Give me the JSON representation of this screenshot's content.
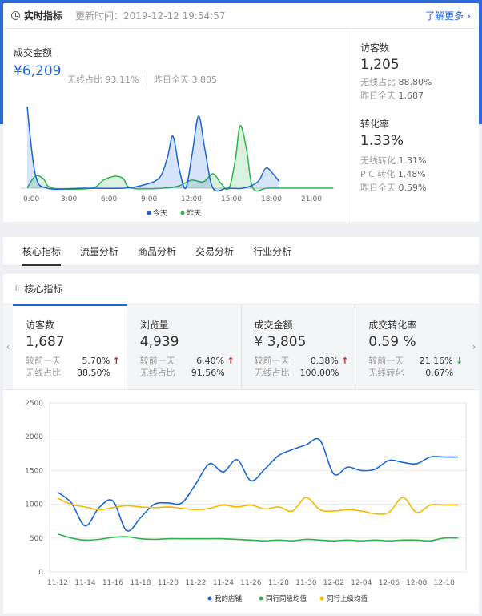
{
  "realtime": {
    "title": "实时指标",
    "update_label": "更新时间：2019-12-12 19:54:57",
    "more_label": "了解更多",
    "gmv": {
      "label": "成交金额",
      "value": "¥6,209",
      "wireless": "无线占比 93.11%",
      "yesterday": "昨日全天 3,805"
    },
    "visitors": {
      "label": "访客数",
      "value": "1,205",
      "wireless_label": "无线占比",
      "wireless_value": "88.80%",
      "yesterday_label": "昨日全天",
      "yesterday_value": "1,687"
    },
    "conversion": {
      "label": "转化率",
      "value": "1.33%",
      "wireless_label": "无线转化",
      "wireless_value": "1.31%",
      "pc_label": "P C 转化",
      "pc_value": "1.48%",
      "yesterday_label": "昨日全天",
      "yesterday_value": "0.59%"
    },
    "chart": {
      "x_ticks": [
        "0:00",
        "3:00",
        "6:00",
        "9:00",
        "12:00",
        "15:00",
        "18:00",
        "21:00"
      ],
      "legend_today": "今天",
      "legend_yesterday": "昨天",
      "color_today": "#1a66d9",
      "color_yesterday": "#2db34a"
    }
  },
  "tabs": [
    "核心指标",
    "流量分析",
    "商品分析",
    "交易分析",
    "行业分析"
  ],
  "core": {
    "title": "核心指标",
    "metrics": [
      {
        "label": "访客数",
        "value": "1,687",
        "r1_label": "较前一天",
        "r1_value": "5.70%",
        "r1_trend": "up",
        "r2_label": "无线占比",
        "r2_value": "88.50%"
      },
      {
        "label": "浏览量",
        "value": "4,939",
        "r1_label": "较前一天",
        "r1_value": "6.40%",
        "r1_trend": "up",
        "r2_label": "无线占比",
        "r2_value": "91.56%"
      },
      {
        "label": "成交金额",
        "value": "¥ 3,805",
        "r1_label": "较前一天",
        "r1_value": "0.38%",
        "r1_trend": "up",
        "r2_label": "无线占比",
        "r2_value": "100.00%"
      },
      {
        "label": "成交转化率",
        "value": "0.59 %",
        "r1_label": "较前一天",
        "r1_value": "21.16%",
        "r1_trend": "down",
        "r2_label": "无线转化",
        "r2_value": "0.67%"
      }
    ]
  },
  "chart_data": {
    "type": "line",
    "categories": [
      "11-12",
      "11-13",
      "11-14",
      "11-15",
      "11-16",
      "11-17",
      "11-18",
      "11-19",
      "11-20",
      "11-21",
      "11-22",
      "11-23",
      "11-24",
      "11-25",
      "11-26",
      "11-27",
      "11-28",
      "11-29",
      "11-30",
      "12-01",
      "12-02",
      "12-03",
      "12-04",
      "12-05",
      "12-06",
      "12-07",
      "12-08",
      "12-09",
      "12-10",
      "12-11"
    ],
    "x_tick_labels": [
      "11-12",
      "11-14",
      "11-16",
      "11-18",
      "11-20",
      "11-22",
      "11-24",
      "11-26",
      "11-28",
      "11-30",
      "12-02",
      "12-04",
      "12-06",
      "12-08",
      "12-10"
    ],
    "ylim": [
      0,
      2500
    ],
    "y_ticks": [
      0,
      500,
      1000,
      1500,
      2000,
      2500
    ],
    "series": [
      {
        "name": "我的店铺",
        "color": "#1a66d9",
        "values": [
          1180,
          1020,
          680,
          950,
          1050,
          610,
          800,
          1000,
          1020,
          1020,
          1300,
          1600,
          1480,
          1660,
          1350,
          1520,
          1720,
          1810,
          1880,
          1950,
          1450,
          1550,
          1500,
          1520,
          1650,
          1620,
          1600,
          1700,
          1700,
          1700
        ]
      },
      {
        "name": "同行同级均值",
        "color": "#2db34a",
        "values": [
          560,
          500,
          470,
          480,
          510,
          520,
          490,
          480,
          490,
          490,
          490,
          490,
          490,
          480,
          470,
          460,
          470,
          460,
          480,
          470,
          460,
          470,
          460,
          470,
          460,
          470,
          470,
          460,
          500,
          500
        ]
      },
      {
        "name": "同行上级均值",
        "color": "#f5b800",
        "values": [
          1090,
          1000,
          960,
          920,
          950,
          980,
          960,
          950,
          960,
          940,
          920,
          940,
          990,
          960,
          990,
          930,
          960,
          900,
          1100,
          920,
          900,
          920,
          900,
          860,
          880,
          1100,
          880,
          990,
          990,
          990
        ]
      }
    ],
    "grid": true,
    "legend_position": "bottom"
  }
}
